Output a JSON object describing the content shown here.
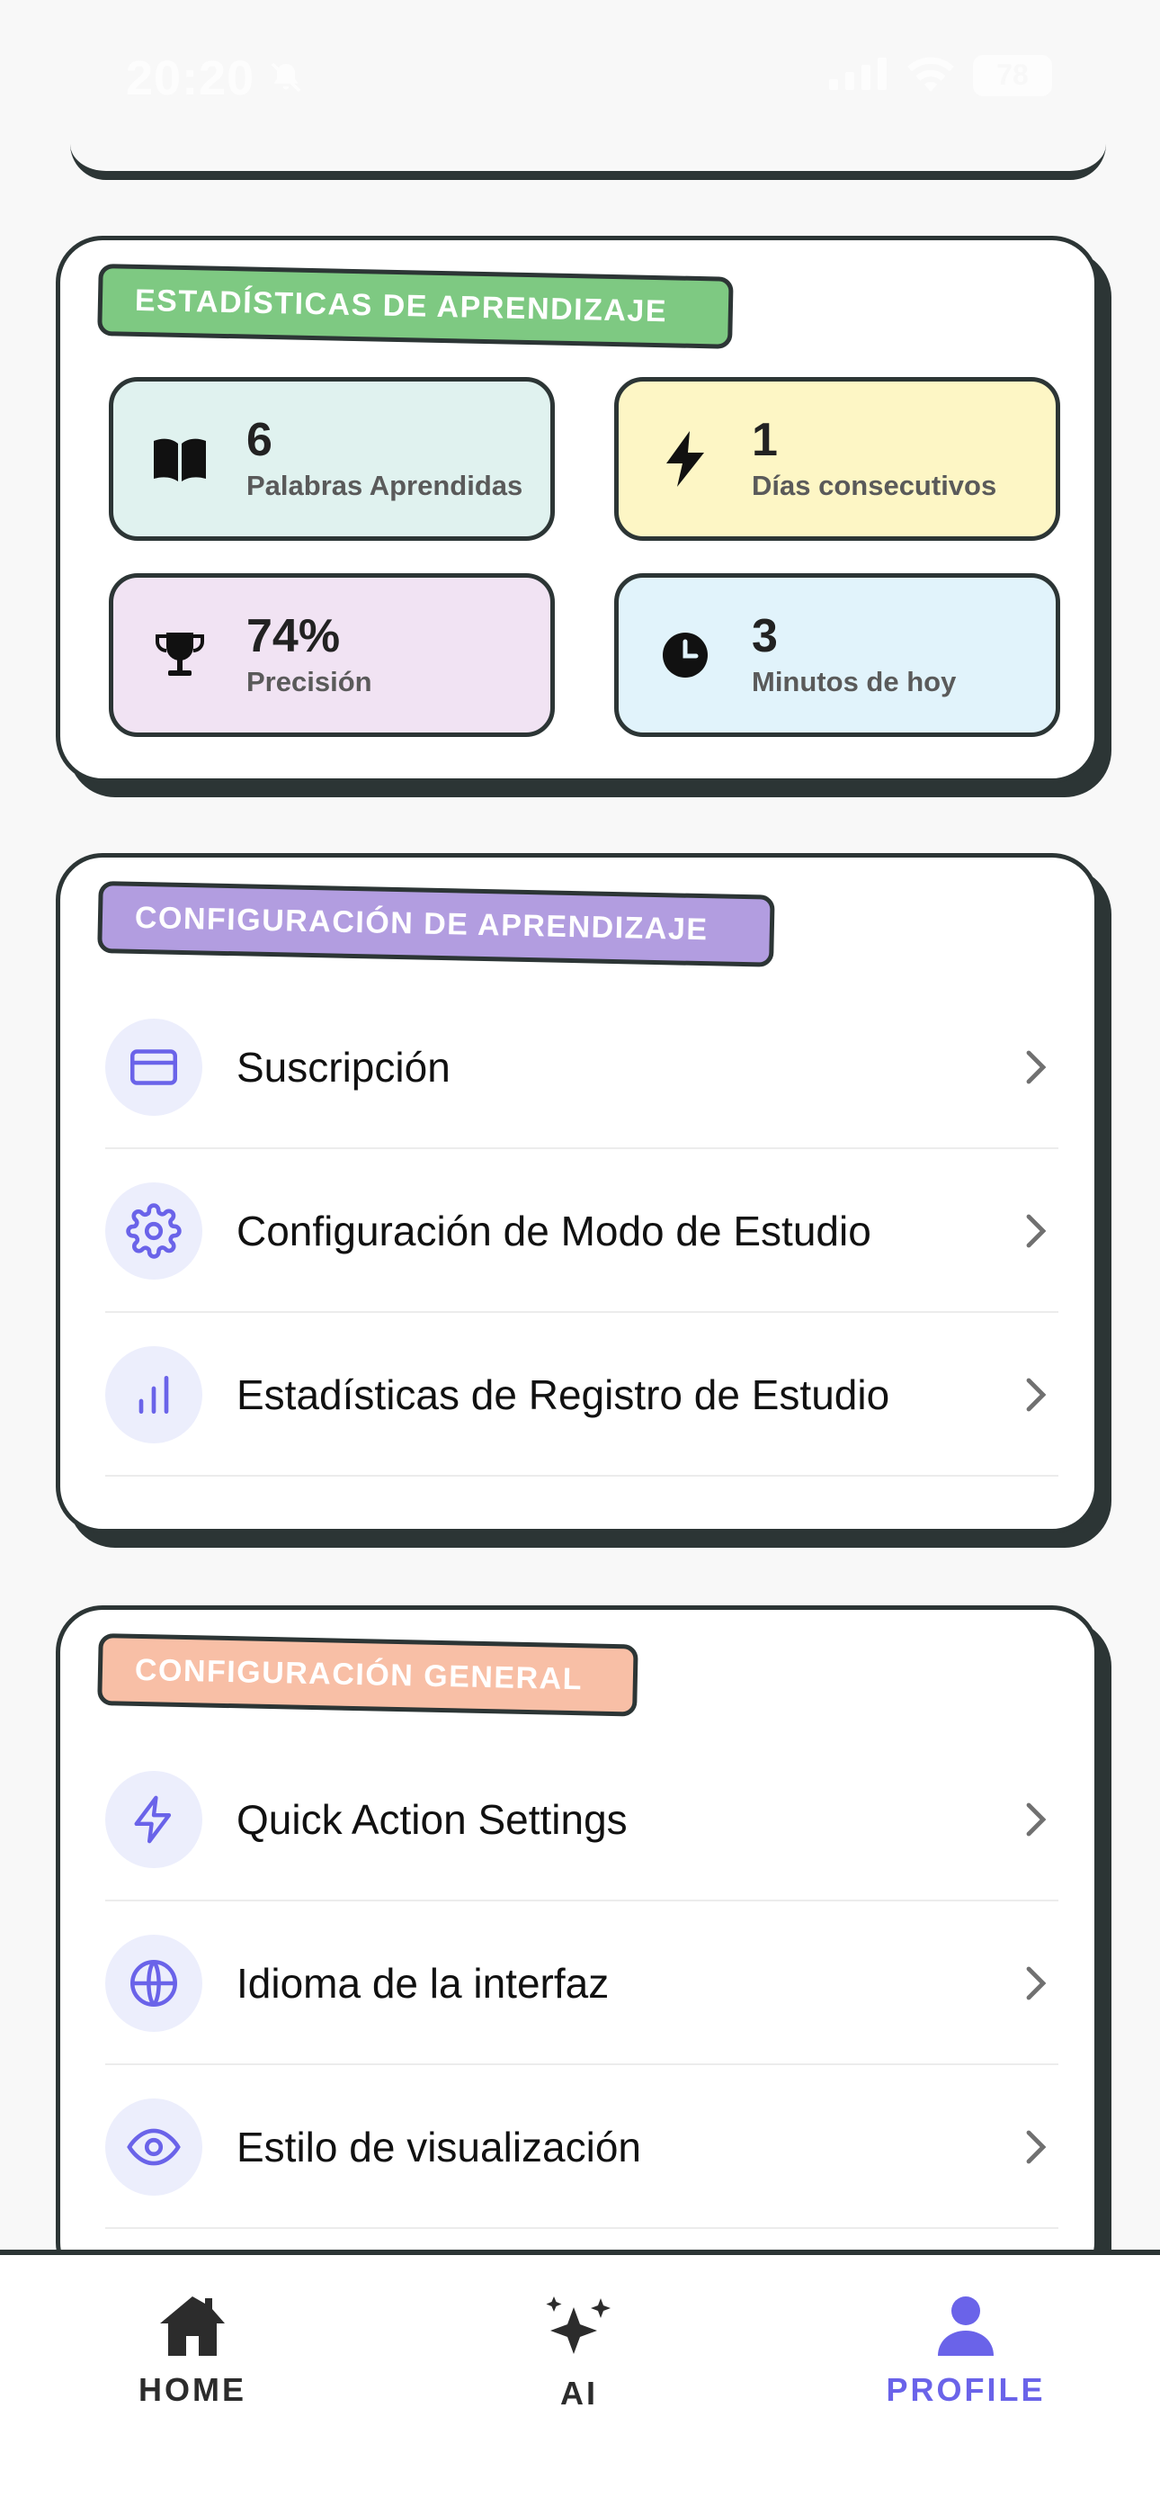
{
  "status_bar": {
    "time": "20:20",
    "battery": "78"
  },
  "stats_card": {
    "tag": "ESTADÍSTICAS DE APRENDIZAJE",
    "tiles": [
      {
        "value": "6",
        "label": "Palabras Aprendidas",
        "icon": "book-icon",
        "bg": "#e0f2ef"
      },
      {
        "value": "1",
        "label": "Días consecutivos",
        "icon": "bolt-icon",
        "bg": "#fdf6c5"
      },
      {
        "value": "74%",
        "label": "Precisión",
        "icon": "trophy-icon",
        "bg": "#f1e3f3"
      },
      {
        "value": "3",
        "label": "Minutos de hoy",
        "icon": "clock-icon",
        "bg": "#e1f3fb"
      }
    ]
  },
  "learning_card": {
    "tag": "CONFIGURACIÓN DE APRENDIZAJE",
    "items": [
      {
        "label": "Suscripción",
        "icon": "credit-card-icon"
      },
      {
        "label": "Configuración de Modo de Estudio",
        "icon": "gear-icon"
      },
      {
        "label": "Estadísticas de Registro de Estudio",
        "icon": "bar-chart-icon"
      }
    ]
  },
  "general_card": {
    "tag": "CONFIGURACIÓN GENERAL",
    "items": [
      {
        "label": "Quick Action Settings",
        "icon": "lightning-icon"
      },
      {
        "label": "Idioma de la interfaz",
        "icon": "globe-icon"
      },
      {
        "label": "Estilo de visualización",
        "icon": "eye-icon"
      }
    ]
  },
  "bottom_nav": {
    "items": [
      {
        "label": "HOME",
        "icon": "home-icon",
        "active": false
      },
      {
        "label": "AI",
        "icon": "sparkles-icon",
        "active": false
      },
      {
        "label": "PROFILE",
        "icon": "user-icon",
        "active": true
      }
    ]
  },
  "colors": {
    "accent": "#6a63e9",
    "outline": "#2c3535",
    "tag_green": "#7ec982",
    "tag_purple": "#b29de0",
    "tag_salmon": "#f8bfa6"
  }
}
